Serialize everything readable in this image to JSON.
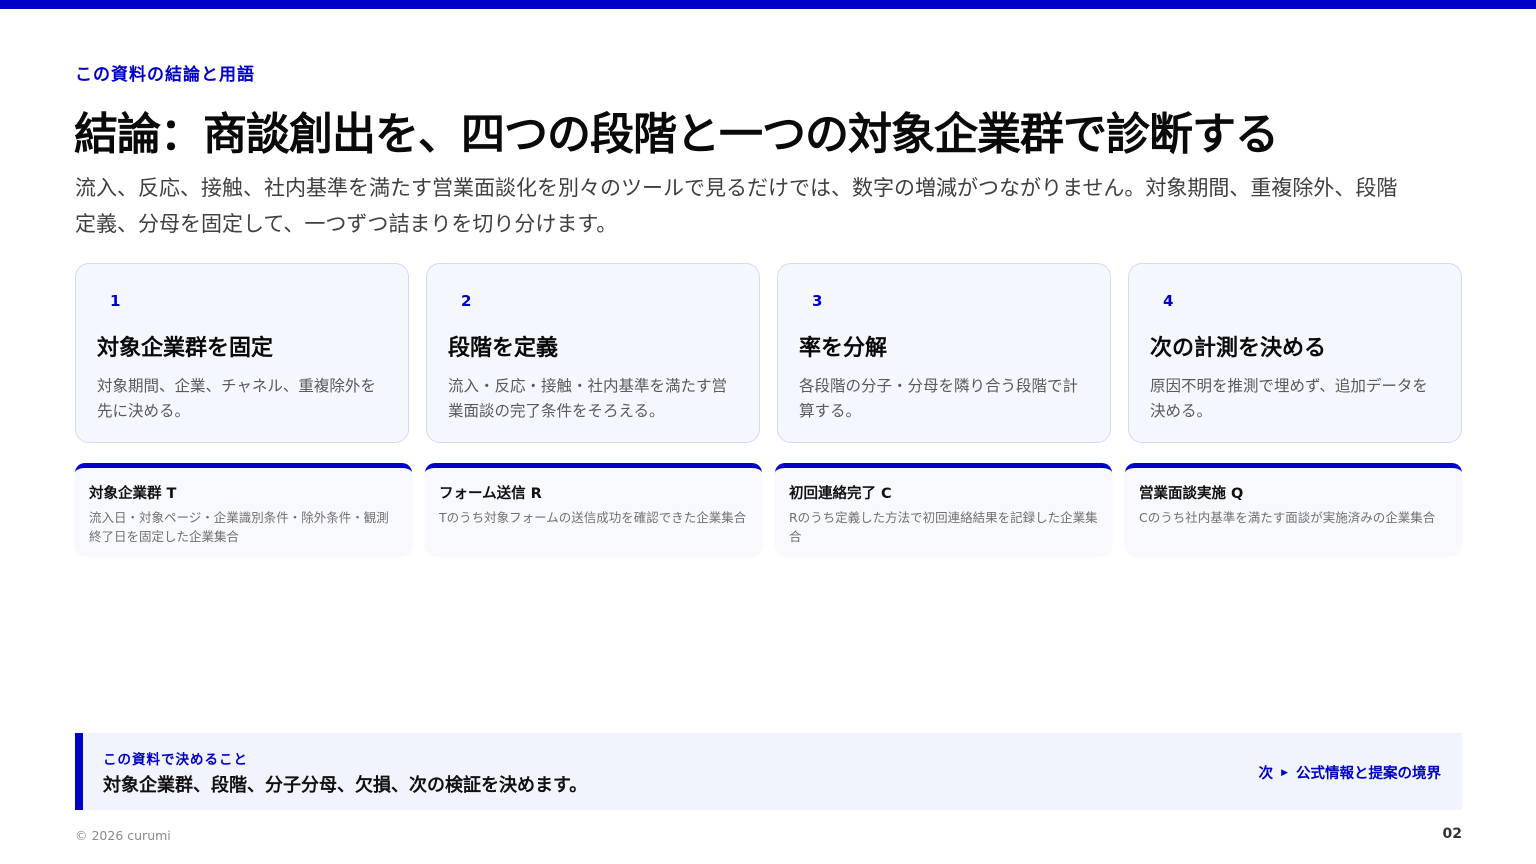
{
  "colors": {
    "accent": "#0000c8",
    "card_bg": "#f5f7ff",
    "summary_bg": "#f2f4fd"
  },
  "eyebrow": "この資料の結論と用語",
  "title": "結論：商談創出を、四つの段階と一つの対象企業群で診断する",
  "lead": "流入、反応、接触、社内基準を満たす営業面談化を別々のツールで見るだけでは、数字の増減がつながりません。対象期間、重複除外、段階定義、分母を固定して、一つずつ詰まりを切り分けます。",
  "steps": [
    {
      "num": "1",
      "title": "対象企業群を固定",
      "desc": "対象期間、企業、チャネル、重複除外を先に決める。"
    },
    {
      "num": "2",
      "title": "段階を定義",
      "desc": "流入・反応・接触・社内基準を満たす営業面談の完了条件をそろえる。"
    },
    {
      "num": "3",
      "title": "率を分解",
      "desc": "各段階の分子・分母を隣り合う段階で計算する。"
    },
    {
      "num": "4",
      "title": "次の計測を決める",
      "desc": "原因不明を推測で埋めず、追加データを決める。"
    }
  ],
  "terms": [
    {
      "name": "対象企業群 T",
      "desc": "流入日・対象ページ・企業識別条件・除外条件・観測終了日を固定した企業集合"
    },
    {
      "name": "フォーム送信 R",
      "desc": "Tのうち対象フォームの送信成功を確認できた企業集合"
    },
    {
      "name": "初回連絡完了 C",
      "desc": "Rのうち定義した方法で初回連絡結果を記録した企業集合"
    },
    {
      "name": "営業面談実施 Q",
      "desc": "Cのうち社内基準を満たす面談が実施済みの企業集合"
    }
  ],
  "summary": {
    "label": "この資料で決めること",
    "text": "対象企業群、段階、分子分母、欠損、次の検証を決めます。",
    "next_prefix": "次",
    "next_label": "公式情報と提案の境界",
    "arrow_icon": "triangle-right-icon"
  },
  "footer": {
    "copyright": "© 2026 curumi",
    "page": "02"
  }
}
